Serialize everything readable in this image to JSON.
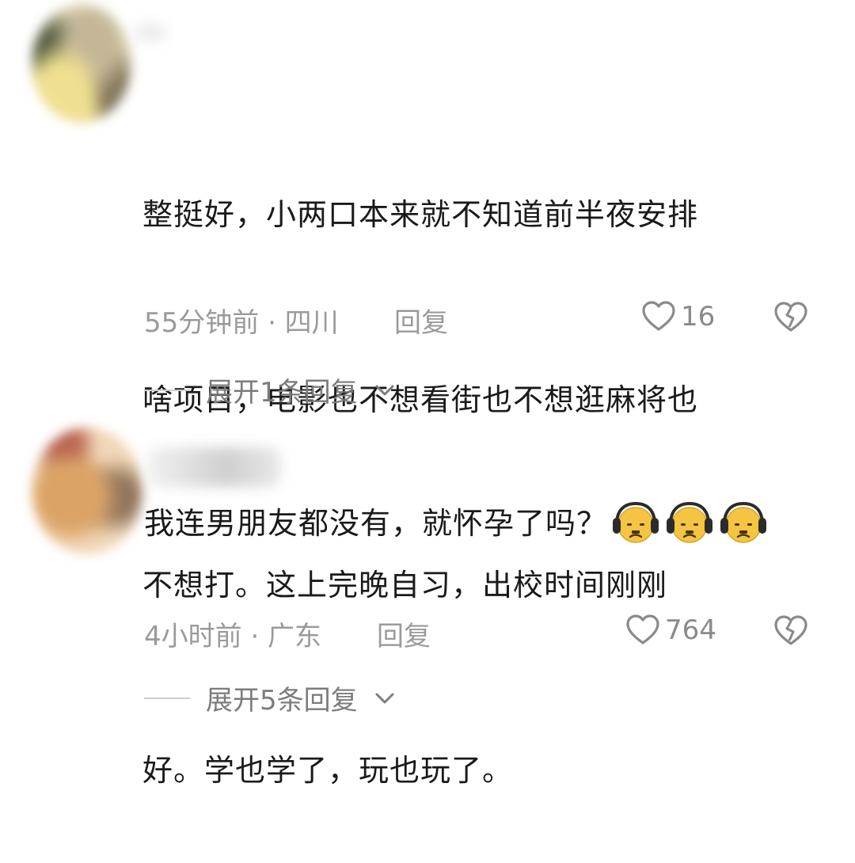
{
  "comments": [
    {
      "text": "整挺好，小两口本来就不知道前半夜安排啥项目，电影也不想看街也不想逛麻将也不想打。这上完晚自习，出校时间刚刚好。学也学了，玩也玩了。",
      "lines": [
        "整挺好，小两口本来就不知道前半夜安排",
        "啥项目，电影也不想看街也不想逛麻将也",
        "不想打。这上完晚自习，出校时间刚刚",
        "好。学也学了，玩也玩了。"
      ],
      "meta": "55分钟前 · 四川",
      "reply_label": "回复",
      "likes": "16",
      "expand_label": "展开1条回复"
    },
    {
      "text": "我连男朋友都没有，就怀孕了吗？",
      "emoji_count": 3,
      "emoji_name": "headphone-frown-emoji",
      "meta": "4小时前 · 广东",
      "reply_label": "回复",
      "likes": "764",
      "expand_label": "展开5条回复"
    }
  ],
  "icons": {
    "like": "heart-outline-icon",
    "dislike": "broken-heart-icon",
    "expand": "chevron-down-icon"
  },
  "colors": {
    "text": "#1a1a1a",
    "meta": "#9a9a9a",
    "emoji_face": "#f6c443",
    "emoji_headphone": "#2b2b2b"
  }
}
